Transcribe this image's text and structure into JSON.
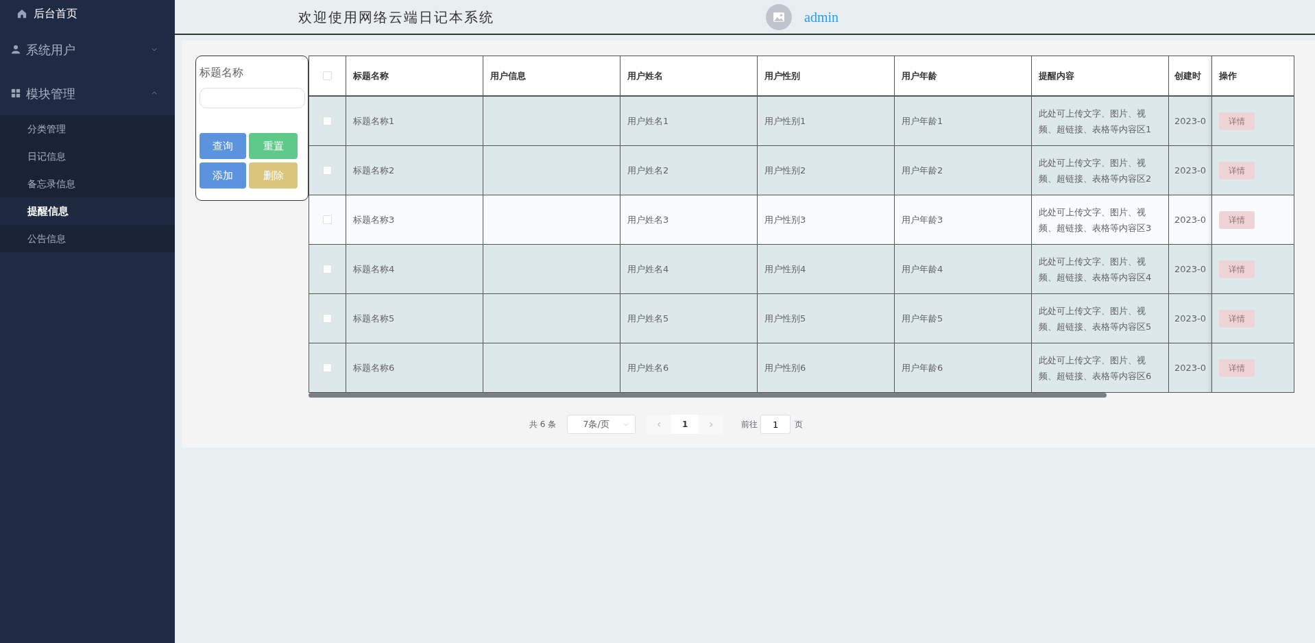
{
  "sidebar": {
    "home": {
      "label": "后台首页"
    },
    "groups": [
      {
        "label": "系统用户",
        "expanded": false
      },
      {
        "label": "模块管理",
        "expanded": true,
        "children": [
          {
            "label": "分类管理",
            "selected": false
          },
          {
            "label": "日记信息",
            "selected": false
          },
          {
            "label": "备忘录信息",
            "selected": false
          },
          {
            "label": "提醒信息",
            "selected": true
          },
          {
            "label": "公告信息",
            "selected": false
          }
        ]
      }
    ]
  },
  "header": {
    "title": "欢迎使用网络云端日记本系统",
    "user": "admin"
  },
  "search": {
    "label": "标题名称",
    "buttons": [
      {
        "label": "查询",
        "kind": "primary"
      },
      {
        "label": "重置",
        "kind": "success"
      },
      {
        "label": "添加",
        "kind": "primary"
      },
      {
        "label": "删除",
        "kind": "warning"
      }
    ]
  },
  "table": {
    "all_checked": false,
    "columns": [
      "标题名称",
      "用户信息",
      "用户姓名",
      "用户性别",
      "用户年龄",
      "提醒内容",
      "创建时",
      "操作"
    ],
    "rows": [
      {
        "checked": false,
        "hovered": false,
        "title": "标题名称1",
        "name": "用户姓名1",
        "gender": "用户性别1",
        "age": "用户年龄1",
        "content": "此处可上传文字、图片、视频、超链接、表格等内容区1",
        "created": "2023-0",
        "action": "详情"
      },
      {
        "checked": false,
        "hovered": false,
        "title": "标题名称2",
        "name": "用户姓名2",
        "gender": "用户性别2",
        "age": "用户年龄2",
        "content": "此处可上传文字、图片、视频、超链接、表格等内容区2",
        "created": "2023-0",
        "action": "详情"
      },
      {
        "checked": false,
        "hovered": true,
        "title": "标题名称3",
        "name": "用户姓名3",
        "gender": "用户性别3",
        "age": "用户年龄3",
        "content": "此处可上传文字、图片、视频、超链接、表格等内容区3",
        "created": "2023-0",
        "action": "详情"
      },
      {
        "checked": false,
        "hovered": false,
        "title": "标题名称4",
        "name": "用户姓名4",
        "gender": "用户性别4",
        "age": "用户年龄4",
        "content": "此处可上传文字、图片、视频、超链接、表格等内容区4",
        "created": "2023-0",
        "action": "详情"
      },
      {
        "checked": false,
        "hovered": false,
        "title": "标题名称5",
        "name": "用户姓名5",
        "gender": "用户性别5",
        "age": "用户年龄5",
        "content": "此处可上传文字、图片、视频、超链接、表格等内容区5",
        "created": "2023-0",
        "action": "详情"
      },
      {
        "checked": false,
        "hovered": false,
        "title": "标题名称6",
        "name": "用户姓名6",
        "gender": "用户性别6",
        "age": "用户年龄6",
        "content": "此处可上传文字、图片、视频、超链接、表格等内容区6",
        "created": "2023-0",
        "action": "详情"
      }
    ]
  },
  "pagination": {
    "total": "共 6 条",
    "page_size": "7条/页",
    "prev": "‹",
    "pages": [
      {
        "label": "1",
        "selected": true
      }
    ],
    "next": "›",
    "goto_label": "前往",
    "goto_value": "1",
    "page_unit": "页"
  }
}
